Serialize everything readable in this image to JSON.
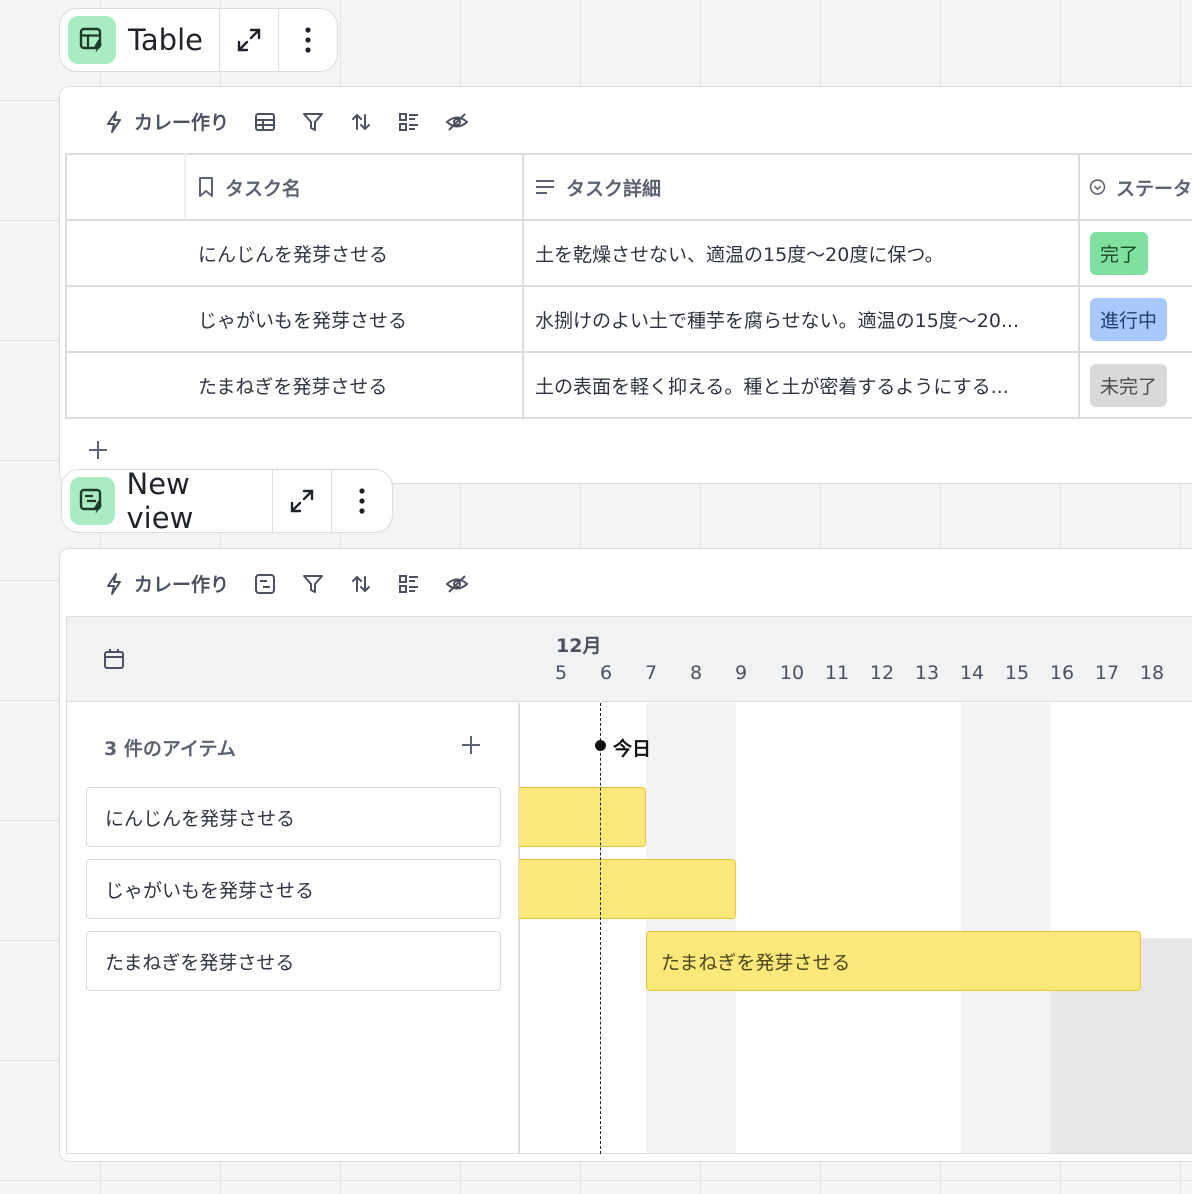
{
  "table_view": {
    "title": "Table",
    "toolbar_automation": "カレー作り",
    "columns": [
      {
        "name": "タスク名",
        "icon": "bookmark-icon"
      },
      {
        "name": "タスク詳細",
        "icon": "text-lines-icon"
      },
      {
        "name": "ステータス",
        "icon": "status-circle-icon"
      }
    ],
    "column_visible_text": [
      "タスク名",
      "タスク詳細",
      "ステータ"
    ],
    "rows": [
      {
        "name": "にんじんを発芽させる",
        "detail": "土を乾燥させない、適温の15度〜20度に保つ。",
        "status": "完了",
        "status_color": "#7fe0a0"
      },
      {
        "name": "じゃがいもを発芽させる",
        "detail": "水捌けのよい土で種芋を腐らせない。適温の15度〜20...",
        "status": "進行中",
        "status_color": "#a9c8fb"
      },
      {
        "name": "たまねぎを発芽させる",
        "detail": "土の表面を軽く抑える。種と土が密着するようにする...",
        "status": "未完了",
        "status_color": "#d9d9db"
      }
    ],
    "add_row": "+"
  },
  "gantt_view": {
    "title": "New view",
    "toolbar_automation": "カレー作り",
    "month": "12月",
    "days": [
      "5",
      "6",
      "7",
      "8",
      "9",
      "10",
      "11",
      "12",
      "13",
      "14",
      "15",
      "16",
      "17",
      "18"
    ],
    "today_label": "今日",
    "item_count": "3 件のアイテム",
    "add": "+",
    "items": [
      "にんじんを発芽させる",
      "じゃがいもを発芽させる",
      "たまねぎを発芽させる"
    ],
    "bar_labels": [
      "",
      "",
      "たまねぎを発芽させる"
    ]
  },
  "colors": {
    "accent_badge": "#a9ecc4",
    "bar_fill": "#fde97a"
  }
}
